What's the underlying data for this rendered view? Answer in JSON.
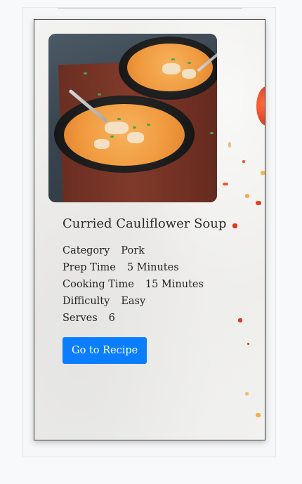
{
  "recipe": {
    "title": "Curried Cauliflower Soup",
    "image_alt": "Bowls of curried cauliflower soup",
    "details": [
      {
        "label": "Category",
        "value": "Pork"
      },
      {
        "label": "Prep Time",
        "value": "5 Minutes"
      },
      {
        "label": "Cooking Time",
        "value": "15 Minutes"
      },
      {
        "label": "Difficulty",
        "value": "Easy"
      },
      {
        "label": "Serves",
        "value": "6"
      }
    ],
    "button_label": "Go to Recipe"
  },
  "colors": {
    "button": "#0b7dff",
    "border": "#3a3a3a"
  }
}
